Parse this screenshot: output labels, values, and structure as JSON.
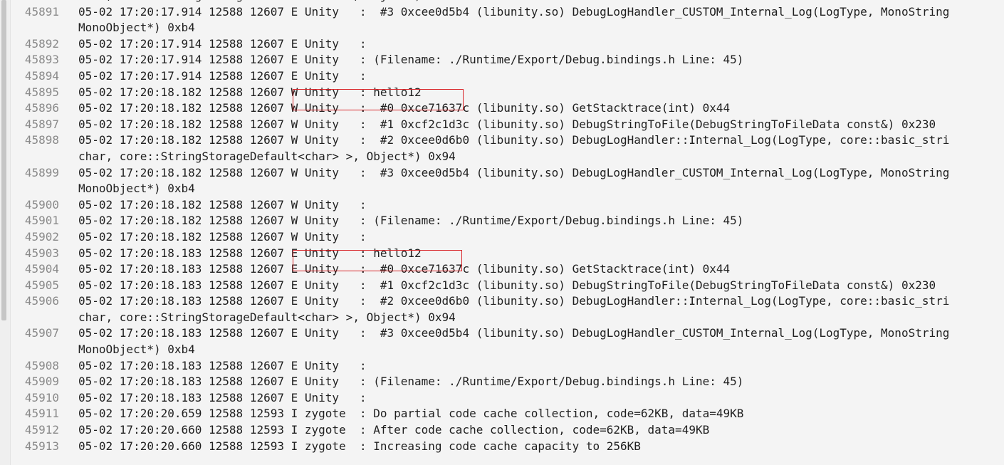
{
  "log": {
    "rows": [
      {
        "n": "",
        "lines": [
          "char, core::StringStorageDefault<char> >, Object*) 0x94"
        ]
      },
      {
        "n": "45891",
        "lines": [
          "05-02 17:20:17.914 12588 12607 E Unity   :  #3 0xcee0d5b4 (libunity.so) DebugLogHandler_CUSTOM_Internal_Log(LogType, MonoString",
          "MonoObject*) 0xb4"
        ]
      },
      {
        "n": "45892",
        "lines": [
          "05-02 17:20:17.914 12588 12607 E Unity   :"
        ]
      },
      {
        "n": "45893",
        "lines": [
          "05-02 17:20:17.914 12588 12607 E Unity   : (Filename: ./Runtime/Export/Debug.bindings.h Line: 45)"
        ]
      },
      {
        "n": "45894",
        "lines": [
          "05-02 17:20:17.914 12588 12607 E Unity   :"
        ]
      },
      {
        "n": "45895",
        "lines": [
          "05-02 17:20:18.182 12588 12607 W Unity   : hello12"
        ]
      },
      {
        "n": "45896",
        "lines": [
          "05-02 17:20:18.182 12588 12607 W Unity   :  #0 0xce71637c (libunity.so) GetStacktrace(int) 0x44"
        ]
      },
      {
        "n": "45897",
        "lines": [
          "05-02 17:20:18.182 12588 12607 W Unity   :  #1 0xcf2c1d3c (libunity.so) DebugStringToFile(DebugStringToFileData const&) 0x230"
        ]
      },
      {
        "n": "45898",
        "lines": [
          "05-02 17:20:18.182 12588 12607 W Unity   :  #2 0xcee0d6b0 (libunity.so) DebugLogHandler::Internal_Log(LogType, core::basic_stri",
          "char, core::StringStorageDefault<char> >, Object*) 0x94"
        ]
      },
      {
        "n": "45899",
        "lines": [
          "05-02 17:20:18.182 12588 12607 W Unity   :  #3 0xcee0d5b4 (libunity.so) DebugLogHandler_CUSTOM_Internal_Log(LogType, MonoString",
          "MonoObject*) 0xb4"
        ]
      },
      {
        "n": "45900",
        "lines": [
          "05-02 17:20:18.182 12588 12607 W Unity   :"
        ]
      },
      {
        "n": "45901",
        "lines": [
          "05-02 17:20:18.182 12588 12607 W Unity   : (Filename: ./Runtime/Export/Debug.bindings.h Line: 45)"
        ]
      },
      {
        "n": "45902",
        "lines": [
          "05-02 17:20:18.182 12588 12607 W Unity   :"
        ]
      },
      {
        "n": "45903",
        "lines": [
          "05-02 17:20:18.183 12588 12607 E Unity   : hello12"
        ]
      },
      {
        "n": "45904",
        "lines": [
          "05-02 17:20:18.183 12588 12607 E Unity   :  #0 0xce71637c (libunity.so) GetStacktrace(int) 0x44"
        ]
      },
      {
        "n": "45905",
        "lines": [
          "05-02 17:20:18.183 12588 12607 E Unity   :  #1 0xcf2c1d3c (libunity.so) DebugStringToFile(DebugStringToFileData const&) 0x230"
        ]
      },
      {
        "n": "45906",
        "lines": [
          "05-02 17:20:18.183 12588 12607 E Unity   :  #2 0xcee0d6b0 (libunity.so) DebugLogHandler::Internal_Log(LogType, core::basic_stri",
          "char, core::StringStorageDefault<char> >, Object*) 0x94"
        ]
      },
      {
        "n": "45907",
        "lines": [
          "05-02 17:20:18.183 12588 12607 E Unity   :  #3 0xcee0d5b4 (libunity.so) DebugLogHandler_CUSTOM_Internal_Log(LogType, MonoString",
          "MonoObject*) 0xb4"
        ]
      },
      {
        "n": "45908",
        "lines": [
          "05-02 17:20:18.183 12588 12607 E Unity   :"
        ]
      },
      {
        "n": "45909",
        "lines": [
          "05-02 17:20:18.183 12588 12607 E Unity   : (Filename: ./Runtime/Export/Debug.bindings.h Line: 45)"
        ]
      },
      {
        "n": "45910",
        "lines": [
          "05-02 17:20:18.183 12588 12607 E Unity   :"
        ]
      },
      {
        "n": "45911",
        "lines": [
          "05-02 17:20:20.659 12588 12593 I zygote  : Do partial code cache collection, code=62KB, data=49KB"
        ]
      },
      {
        "n": "45912",
        "lines": [
          "05-02 17:20:20.660 12588 12593 I zygote  : After code cache collection, code=62KB, data=49KB"
        ]
      },
      {
        "n": "45913",
        "lines": [
          "05-02 17:20:20.660 12588 12593 I zygote  : Increasing code cache capacity to 256KB"
        ]
      }
    ]
  },
  "colors": {
    "background": "#f4f4f4",
    "line_number": "#8a8a8a",
    "text": "#1f1f1f",
    "highlight_box": "#d9262a"
  }
}
